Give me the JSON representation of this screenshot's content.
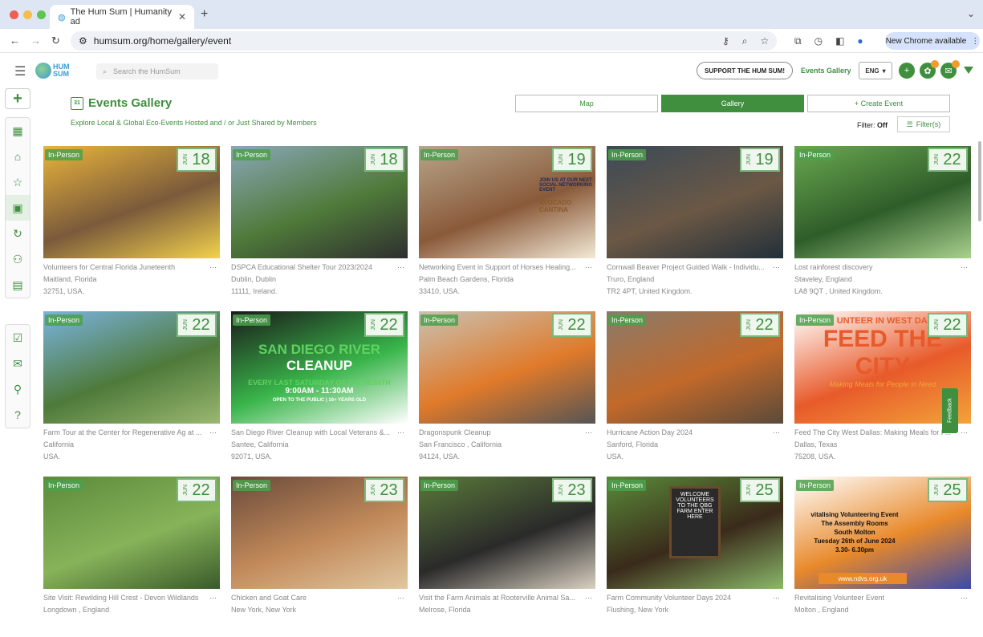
{
  "browser": {
    "tab_title": "The Hum Sum | Humanity ad",
    "url": "humsum.org/home/gallery/event",
    "new_chrome": "New Chrome available"
  },
  "header": {
    "search_placeholder": "Search the HumSum",
    "support_label": "SUPPORT THE HUM SUM!",
    "events_gallery_link": "Events Gallery",
    "language": "ENG",
    "logo_text_1": "HUM",
    "logo_text_2": "SUM"
  },
  "page": {
    "title": "Events Gallery",
    "subtitle": "Explore Local & Global Eco-Events Hosted and / or Just Shared by Members",
    "map_label": "Map",
    "gallery_label": "Gallery",
    "create_label": "+ Create Event",
    "filter_label": "Filter:",
    "filter_state": "Off",
    "filters_button": "Filter(s)",
    "feedback": "Feedback"
  },
  "events": [
    {
      "tag": "In-Person",
      "month": "JUN",
      "day": "18",
      "name": "Volunteers for Central Florida Juneteenth",
      "city": "Maitland, Florida",
      "postal": "32751, USA.",
      "colors": [
        "#e9b43b",
        "#7a5a3b",
        "#f2d24b"
      ]
    },
    {
      "tag": "In-Person",
      "month": "JUN",
      "day": "18",
      "name": "DSPCA Educational Shelter Tour 2023/2024",
      "city": "Dublin, Dublin",
      "postal": "11111, Ireland.",
      "colors": [
        "#8aa7b8",
        "#4f7a3a",
        "#2f2f2f"
      ]
    },
    {
      "tag": "In-Person",
      "month": "JUN",
      "day": "19",
      "name": "Networking Event in Support of Horses Healing...",
      "city": "Palm Beach Gardens, Florida",
      "postal": "33410, USA.",
      "colors": [
        "#b7a58a",
        "#8a5a3a",
        "#f3ead7"
      ]
    },
    {
      "tag": "In-Person",
      "month": "JUN",
      "day": "19",
      "name": "Cornwall Beaver Project Guided Walk - Individu...",
      "city": "Truro, England",
      "postal": "TR2 4PT, United Kingdom.",
      "colors": [
        "#3b4a57",
        "#6b5845",
        "#22303a"
      ]
    },
    {
      "tag": "In-Person",
      "month": "JUN",
      "day": "22",
      "name": "Lost rainforest discovery",
      "city": "Staveley, England",
      "postal": "LA8 9QT , United Kingdom.",
      "colors": [
        "#6aa84f",
        "#2f5d2a",
        "#a9d18e"
      ]
    },
    {
      "tag": "In-Person",
      "month": "JUN",
      "day": "22",
      "name": "Farm Tour at the Center for Regenerative Ag at ...",
      "city": "California",
      "postal": "USA.",
      "colors": [
        "#7ab3e0",
        "#4e7a3a",
        "#9ab870"
      ]
    },
    {
      "tag": "In-Person",
      "month": "JUN",
      "day": "22",
      "name": "San Diego River Cleanup with Local Veterans &...",
      "city": "Santee, California",
      "postal": "92071, USA.",
      "colors": [
        "#1a1a1a",
        "#39b54a",
        "#ffffff"
      ]
    },
    {
      "tag": "In-Person",
      "month": "JUN",
      "day": "22",
      "name": "Dragonspunk Cleanup",
      "city": "San Francisco , California",
      "postal": "94124, USA.",
      "colors": [
        "#c9c1b2",
        "#e07a2a",
        "#555555"
      ]
    },
    {
      "tag": "In-Person",
      "month": "JUN",
      "day": "22",
      "name": "Hurricane Action Day 2024",
      "city": "Sanford, Florida",
      "postal": "USA.",
      "colors": [
        "#8a7a6a",
        "#c2692a",
        "#5a4a3a"
      ]
    },
    {
      "tag": "In-Person",
      "month": "JUN",
      "day": "22",
      "name": "Feed The City West Dallas: Making Meals for P...",
      "city": "Dallas, Texas",
      "postal": "75208, USA.",
      "colors": [
        "#ffffff",
        "#e85a2a",
        "#f2a33a"
      ]
    },
    {
      "tag": "In-Person",
      "month": "JUN",
      "day": "22",
      "name": "Site Visit: Rewilding Hill Crest - Devon Wildlands",
      "city": "Longdown , England",
      "postal": "",
      "colors": [
        "#5c8a3a",
        "#87b35a",
        "#3a5a2a"
      ]
    },
    {
      "tag": "In-Person",
      "month": "JUN",
      "day": "23",
      "name": "Chicken and Goat Care",
      "city": "New York, New York",
      "postal": "",
      "colors": [
        "#6a4a3a",
        "#c28a5a",
        "#e0c7a0"
      ]
    },
    {
      "tag": "In-Person",
      "month": "JUN",
      "day": "23",
      "name": "Visit the Farm Animals at Rooterville Animal Sa...",
      "city": "Melrose, Florida",
      "postal": "",
      "colors": [
        "#5a7a3a",
        "#2a2a2a",
        "#d9d0c0"
      ]
    },
    {
      "tag": "In-Person",
      "month": "JUN",
      "day": "25",
      "name": "Farm Community Volunteer Days 2024",
      "city": "Flushing, New York",
      "postal": "",
      "colors": [
        "#5a8a3a",
        "#3a2a1a",
        "#8ab86a"
      ]
    },
    {
      "tag": "In-Person",
      "month": "JUN",
      "day": "25",
      "name": "Revitalising Volunteer Event",
      "city": "Molton , England",
      "postal": "",
      "colors": [
        "#ffffff",
        "#e8892a",
        "#3a4aa8"
      ]
    }
  ],
  "poster_text": {
    "sd_1": "SAN DIEGO RIVER",
    "sd_2": "CLEANUP",
    "sd_3": "EVERY LAST SATURDAY OF THE MONTH",
    "sd_4": "9:00AM - 11:30AM",
    "sd_5": "OPEN TO THE PUBLIC | 16+ YEARS OLD",
    "ftc_1": "UNTEER IN WEST DALLAS, T",
    "ftc_2": "FEED THE CITY",
    "ftc_3": "Making Meals for People in Need",
    "rv_1": "vitalising Volunteering Event",
    "rv_2": "The Assembly Rooms",
    "rv_3": "South Molton",
    "rv_4": "Tuesday 26th of June 2024",
    "rv_5": "3.30- 6.30pm",
    "rv_6": "www.ndvs.org.uk",
    "hh_1": "JOIN US AT OUR NEXT SOCIAL NETWORKING EVENT",
    "hh_2": "AVOCADO CANTINA",
    "wv_1": "WELCOME VOLUNTEERS TO THE QBG FARM ENTER HERE"
  }
}
